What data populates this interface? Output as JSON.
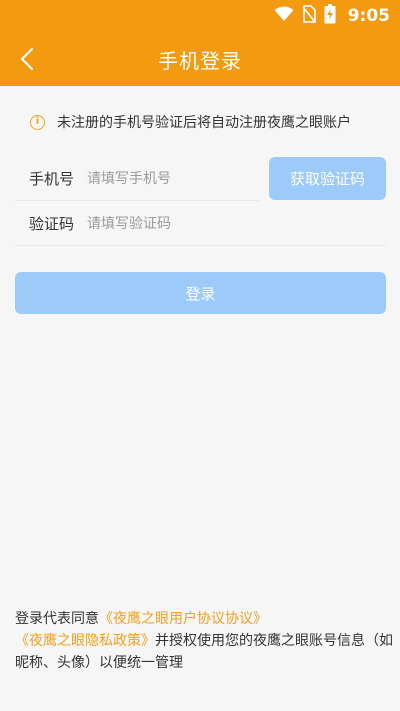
{
  "status_bar": {
    "time": "9:05",
    "icons": [
      "wifi-icon",
      "no-sim-icon",
      "battery-charging-icon"
    ]
  },
  "header": {
    "back_icon": "chevron-left-icon",
    "title": "手机登录"
  },
  "notice": {
    "icon": "info-icon",
    "text": "未注册的手机号验证后将自动注册夜鹰之眼账户"
  },
  "form": {
    "phone_label": "手机号",
    "phone_placeholder": "请填写手机号",
    "code_label": "验证码",
    "code_placeholder": "请填写验证码",
    "get_code_button": "获取验证码",
    "login_button": "登录"
  },
  "agreement": {
    "prefix": "登录代表同意",
    "user_agreement": "《夜鹰之眼用户协议协议》",
    "privacy_policy": "《夜鹰之眼隐私政策》",
    "suffix": "并授权使用您的夜鹰之眼账号信息（如昵称、头像）以便统一管理"
  },
  "colors": {
    "brand": "#f39a10",
    "button_disabled": "#9ccbfa",
    "link": "#f3a020",
    "background": "#f6f6f6"
  }
}
